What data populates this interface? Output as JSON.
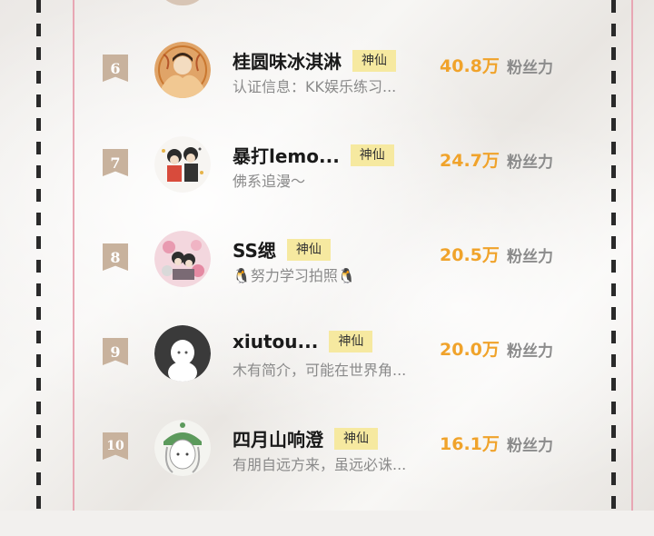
{
  "entries": [
    {
      "rank": "6",
      "name": "桂圆味冰淇淋",
      "tag": "神仙",
      "desc": "认证信息：KK娱乐练习...",
      "count": "40.8万",
      "fans_label": "粉丝力"
    },
    {
      "rank": "7",
      "name": "暴打lemo...",
      "tag": "神仙",
      "desc": "佛系追漫～",
      "count": "24.7万",
      "fans_label": "粉丝力"
    },
    {
      "rank": "8",
      "name": "SS缌",
      "tag": "神仙",
      "desc": "🐧努力学习拍照🐧",
      "count": "20.5万",
      "fans_label": "粉丝力"
    },
    {
      "rank": "9",
      "name": "xiutou...",
      "tag": "神仙",
      "desc": "木有简介，可能在世界角...",
      "count": "20.0万",
      "fans_label": "粉丝力"
    },
    {
      "rank": "10",
      "name": "四月山响澄",
      "tag": "神仙",
      "desc": "有朋自远方来，虽远必诛...",
      "count": "16.1万",
      "fans_label": "粉丝力"
    }
  ],
  "colors": {
    "count": "#f0a32b",
    "badge": "#c8b29d",
    "tag_bg": "#f6e9a0",
    "accent_line": "#e8a7b4"
  }
}
